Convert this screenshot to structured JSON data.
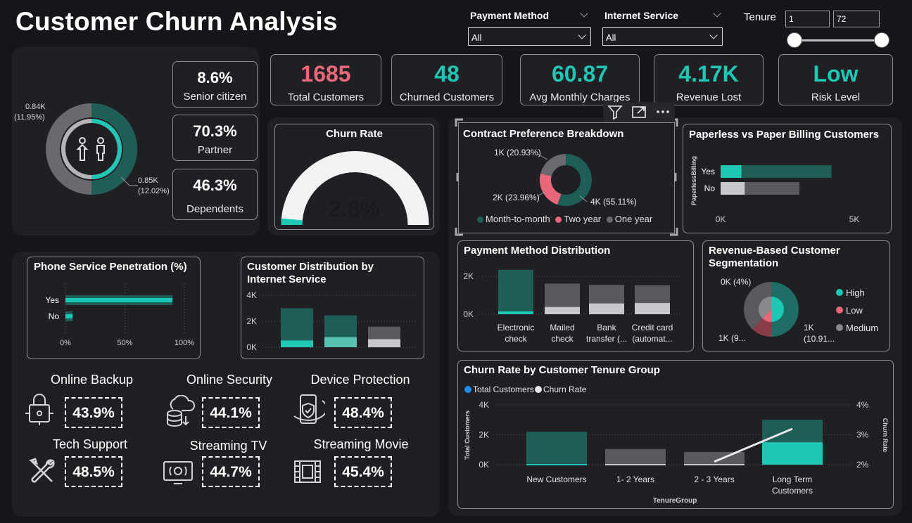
{
  "header": {
    "title": "Customer Churn Analysis"
  },
  "filters": {
    "payment_method": {
      "label": "Payment Method",
      "value": "All"
    },
    "internet_service": {
      "label": "Internet Service",
      "value": "All"
    },
    "tenure": {
      "label": "Tenure",
      "min": "1",
      "max": "72"
    }
  },
  "demographics": {
    "donut_labels": {
      "upper": "0.84K",
      "upper_pct": "(11.95%)",
      "lower": "0.85K",
      "lower_pct": "(12.02%)"
    },
    "cards": [
      {
        "value": "8.6%",
        "label": "Senior citizen"
      },
      {
        "value": "70.3%",
        "label": "Partner"
      },
      {
        "value": "46.3%",
        "label": "Dependents"
      }
    ]
  },
  "kpis": [
    {
      "value": "1685",
      "label": "Total Customers",
      "color": "#e8677a"
    },
    {
      "value": "48",
      "label": "Churned Customers",
      "color": "#1ec8b4"
    },
    {
      "value": "60.87",
      "label": "Avg Monthly Charges",
      "color": "#1ec8b4"
    },
    {
      "value": "4.17K",
      "label": "Revenue Lost",
      "color": "#1ec8b4"
    },
    {
      "value": "Low",
      "label": "Risk Level",
      "color": "#1ec8b4"
    }
  ],
  "churn_rate": {
    "title": "Churn Rate",
    "value": "2.8%",
    "fraction": 0.028
  },
  "services": [
    {
      "name": "Online Backup",
      "value": "43.9%",
      "icon": "lock-icon"
    },
    {
      "name": "Online Security",
      "value": "44.1%",
      "icon": "cloud-database-icon"
    },
    {
      "name": "Device Protection",
      "value": "48.4%",
      "icon": "phone-shield-icon"
    },
    {
      "name": "Tech Support",
      "value": "48.5%",
      "icon": "tools-icon"
    },
    {
      "name": "Streaming TV",
      "value": "44.7%",
      "icon": "tv-icon"
    },
    {
      "name": "Streaming Movie",
      "value": "45.4%",
      "icon": "film-icon"
    }
  ],
  "visual_toolbar": {
    "icons": [
      "filter-icon",
      "focus-mode-icon",
      "more-options-icon"
    ]
  },
  "colors": {
    "teal": "#1ec8b4",
    "dark_teal": "#1f5e56",
    "coral": "#e8677a",
    "gray": "#5a5a5e",
    "light_gray": "#b9b9bd"
  },
  "chart_data": [
    {
      "id": "phone_service",
      "type": "bar",
      "title": "Phone Service Penetration (%)",
      "categories": [
        "Yes",
        "No"
      ],
      "series": [
        {
          "values": [
            90,
            6
          ]
        }
      ],
      "xlim": [
        0,
        100
      ],
      "x_ticks": [
        "0%",
        "50%",
        "100%"
      ]
    },
    {
      "id": "internet_service",
      "type": "bar",
      "title": "Customer Distribution by Internet Service",
      "categories": [
        "",
        "",
        ""
      ],
      "series": [
        {
          "values": [
            3000,
            2450,
            1580
          ]
        },
        {
          "values": [
            520,
            780,
            620
          ]
        }
      ],
      "ylim": [
        0,
        4000
      ],
      "y_ticks": [
        "0K",
        "2K",
        "4K"
      ]
    },
    {
      "id": "contract",
      "type": "pie",
      "title": "Contract Preference Breakdown",
      "slices": [
        {
          "label": "Month-to-month",
          "value": 55.11,
          "text": "4K (55.11%)"
        },
        {
          "label": "Two year",
          "value": 23.96,
          "text": "2K (23.96%)"
        },
        {
          "label": "One year",
          "value": 20.93,
          "text": "1K (20.93%)"
        }
      ]
    },
    {
      "id": "billing",
      "type": "bar",
      "title": "Paperless vs Paper Billing Customers",
      "ylabel": "PaperlessBilling",
      "categories": [
        "Yes",
        "No"
      ],
      "series": [
        {
          "values": [
            4150,
            2950
          ]
        },
        {
          "values": [
            780,
            900
          ]
        }
      ],
      "xlim": [
        0,
        5000
      ],
      "x_ticks": [
        "0K",
        "5K"
      ]
    },
    {
      "id": "payment_method",
      "type": "bar",
      "title": "Payment Method Distribution",
      "categories": [
        "Electronic check",
        "Mailed check",
        "Bank transfer (...",
        "Credit card (automat..."
      ],
      "series": [
        {
          "values": [
            2350,
            1620,
            1550,
            1530
          ]
        },
        {
          "values": [
            150,
            380,
            570,
            590
          ]
        }
      ],
      "ylim": [
        0,
        2600
      ],
      "y_ticks": [
        "0K",
        "2K"
      ]
    },
    {
      "id": "revenue_segmentation",
      "type": "pie",
      "title": "Revenue-Based Customer Segmentation",
      "legend": [
        "High",
        "Low",
        "Medium"
      ],
      "annotations": [
        "0K (4%)",
        "1K (9...",
        "1K (10.91..."
      ],
      "slices": [
        {
          "label": "High",
          "value": 50
        },
        {
          "label": "Low",
          "value": 12
        },
        {
          "label": "Medium",
          "value": 38
        }
      ]
    },
    {
      "id": "tenure_group",
      "type": "bar",
      "title": "Churn Rate by Customer Tenure Group",
      "xlabel": "TenureGroup",
      "ylabel": "Total Customers",
      "y2label": "Churn Rate",
      "legend": [
        "Total Customers",
        "Churn Rate"
      ],
      "categories": [
        "New Customers",
        "1- 2 Years",
        "2 - 3 Years",
        "Long Term Customers"
      ],
      "series": [
        {
          "name": "Total Customers",
          "values": [
            2200,
            1050,
            850,
            3000
          ]
        },
        {
          "name": "Churn Rate",
          "values": [
            null,
            null,
            2.1,
            3.2
          ]
        }
      ],
      "ylim": [
        0,
        4000
      ],
      "y_ticks": [
        "0K",
        "2K",
        "4K"
      ],
      "y2lim": [
        2,
        4
      ],
      "y2_ticks": [
        "2%",
        "3%",
        "4%"
      ]
    }
  ]
}
